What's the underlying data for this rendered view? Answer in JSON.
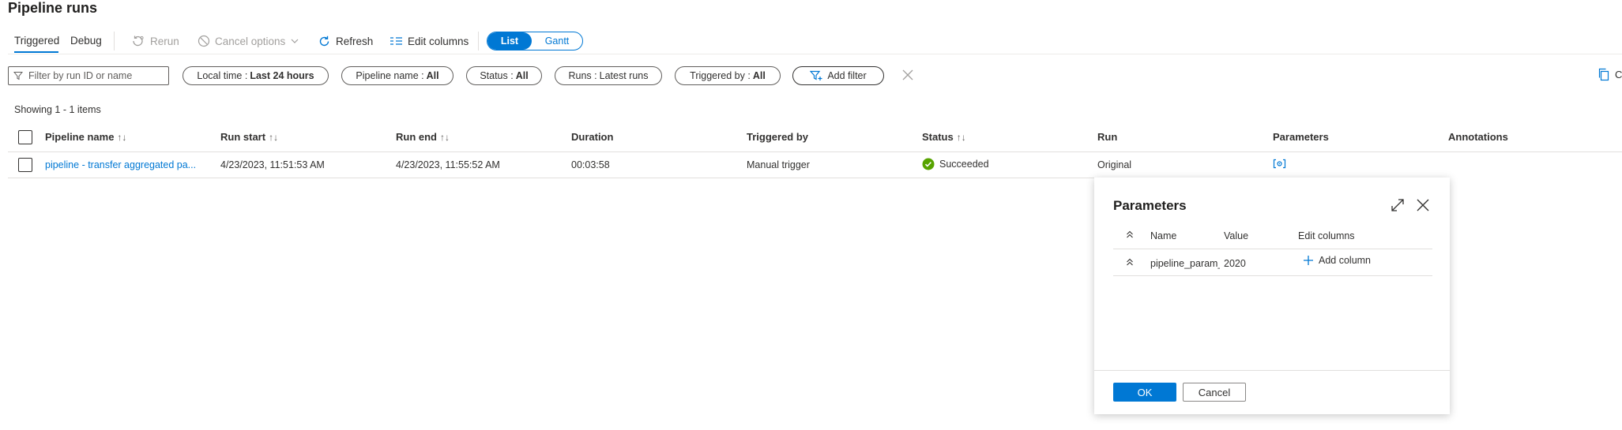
{
  "page": {
    "title": "Pipeline runs"
  },
  "tabs": [
    {
      "label": "Triggered",
      "active": true
    },
    {
      "label": "Debug",
      "active": false
    }
  ],
  "toolbar": {
    "rerun": "Rerun",
    "cancel_options": "Cancel options",
    "refresh": "Refresh",
    "edit_columns": "Edit columns",
    "view_list": "List",
    "view_gantt": "Gantt"
  },
  "filter": {
    "placeholder": "Filter by run ID or name",
    "pills": [
      {
        "label": "Local time :",
        "value": "Last 24 hours"
      },
      {
        "label": "Pipeline name :",
        "value": "All"
      },
      {
        "label": "Status :",
        "value": "All"
      },
      {
        "label": "Runs :",
        "value": "Latest runs"
      },
      {
        "label": "Triggered by :",
        "value": "All"
      }
    ],
    "add_filter": "Add filter",
    "copy_label": "C"
  },
  "results": {
    "count_text": "Showing 1 - 1 items"
  },
  "table": {
    "headers": {
      "pipeline_name": "Pipeline name",
      "run_start": "Run start",
      "run_end": "Run end",
      "duration": "Duration",
      "triggered_by": "Triggered by",
      "status": "Status",
      "run": "Run",
      "parameters": "Parameters",
      "annotations": "Annotations"
    },
    "rows": [
      {
        "pipeline_name": "pipeline - transfer aggregated pa...",
        "run_start": "4/23/2023, 11:51:53 AM",
        "run_end": "4/23/2023, 11:55:52 AM",
        "duration": "00:03:58",
        "triggered_by": "Manual trigger",
        "status": "Succeeded",
        "run": "Original"
      }
    ]
  },
  "params_panel": {
    "title": "Parameters",
    "headers": {
      "name": "Name",
      "value": "Value",
      "edit_columns": "Edit columns"
    },
    "rows": [
      {
        "name": "pipeline_param_fisc",
        "value": "2020"
      }
    ],
    "add_column": "Add column",
    "ok": "OK",
    "cancel": "Cancel"
  },
  "colors": {
    "accent": "#0078d4",
    "success": "#57a300",
    "text": "#323130",
    "border": "#605e5c"
  }
}
